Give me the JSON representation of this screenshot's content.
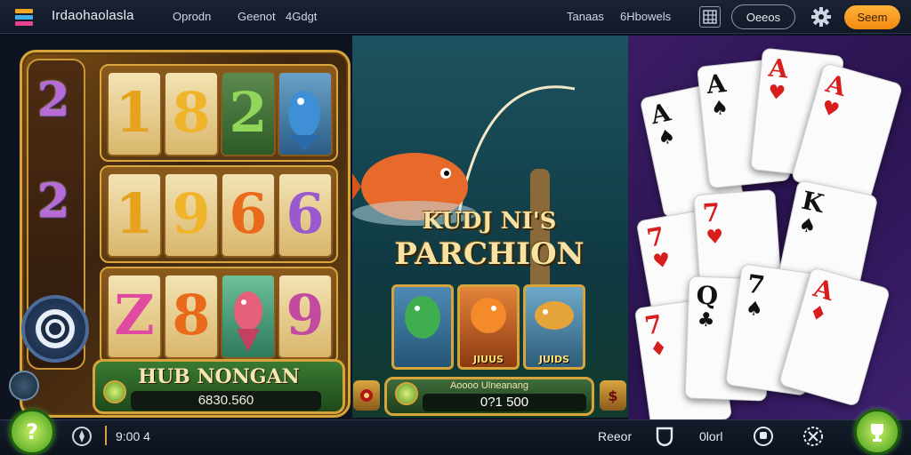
{
  "header": {
    "app_title": "Irdaohaolasla",
    "link_1": "Oprodn",
    "link_2": "Geenot",
    "link_3": "4Gdgt",
    "link_4": "Tanaas",
    "link_5": "6Hbowels",
    "outline_button": "Oeeos",
    "primary_button": "Seem"
  },
  "slot": {
    "side_numbers": [
      "2",
      "2"
    ],
    "rows": [
      [
        "1",
        "8",
        "2",
        "fish"
      ],
      [
        "1",
        "9",
        "6",
        "6"
      ],
      [
        "Z",
        "8",
        "fish",
        "9"
      ]
    ],
    "hub_title": "HUB NONGAN",
    "hub_value": "6830.560"
  },
  "fishing": {
    "title_line1": "KUDJ NI'S",
    "title_line2": "PARCHION",
    "thumbnails": [
      "",
      "JIUUS",
      "JUIDS"
    ],
    "bet_label": "Aoooo Ulneanang",
    "bet_value": "0?1 500",
    "bet_button_right": "$"
  },
  "cards": [
    {
      "rank": "A",
      "suit": "♠",
      "color": "black"
    },
    {
      "rank": "A",
      "suit": "♠",
      "color": "black"
    },
    {
      "rank": "A",
      "suit": "♥",
      "color": "red"
    },
    {
      "rank": "A",
      "suit": "♥",
      "color": "red"
    },
    {
      "rank": "7",
      "suit": "♥",
      "color": "red"
    },
    {
      "rank": "7",
      "suit": "♥",
      "color": "red"
    },
    {
      "rank": "K",
      "suit": "♠",
      "color": "black"
    },
    {
      "rank": "7",
      "suit": "♦",
      "color": "red"
    },
    {
      "rank": "Q",
      "suit": "♣",
      "color": "black"
    },
    {
      "rank": "7",
      "suit": "♠",
      "color": "black"
    },
    {
      "rank": "A",
      "suit": "♦",
      "color": "red"
    }
  ],
  "footer": {
    "time_display": "9:00 4",
    "reset_label": "Reeor",
    "count_label": "0lorl"
  },
  "colors": {
    "accent_gold": "#d7a43b",
    "primary_orange": "#f7a12a",
    "cards_bg": "#2a1450"
  }
}
